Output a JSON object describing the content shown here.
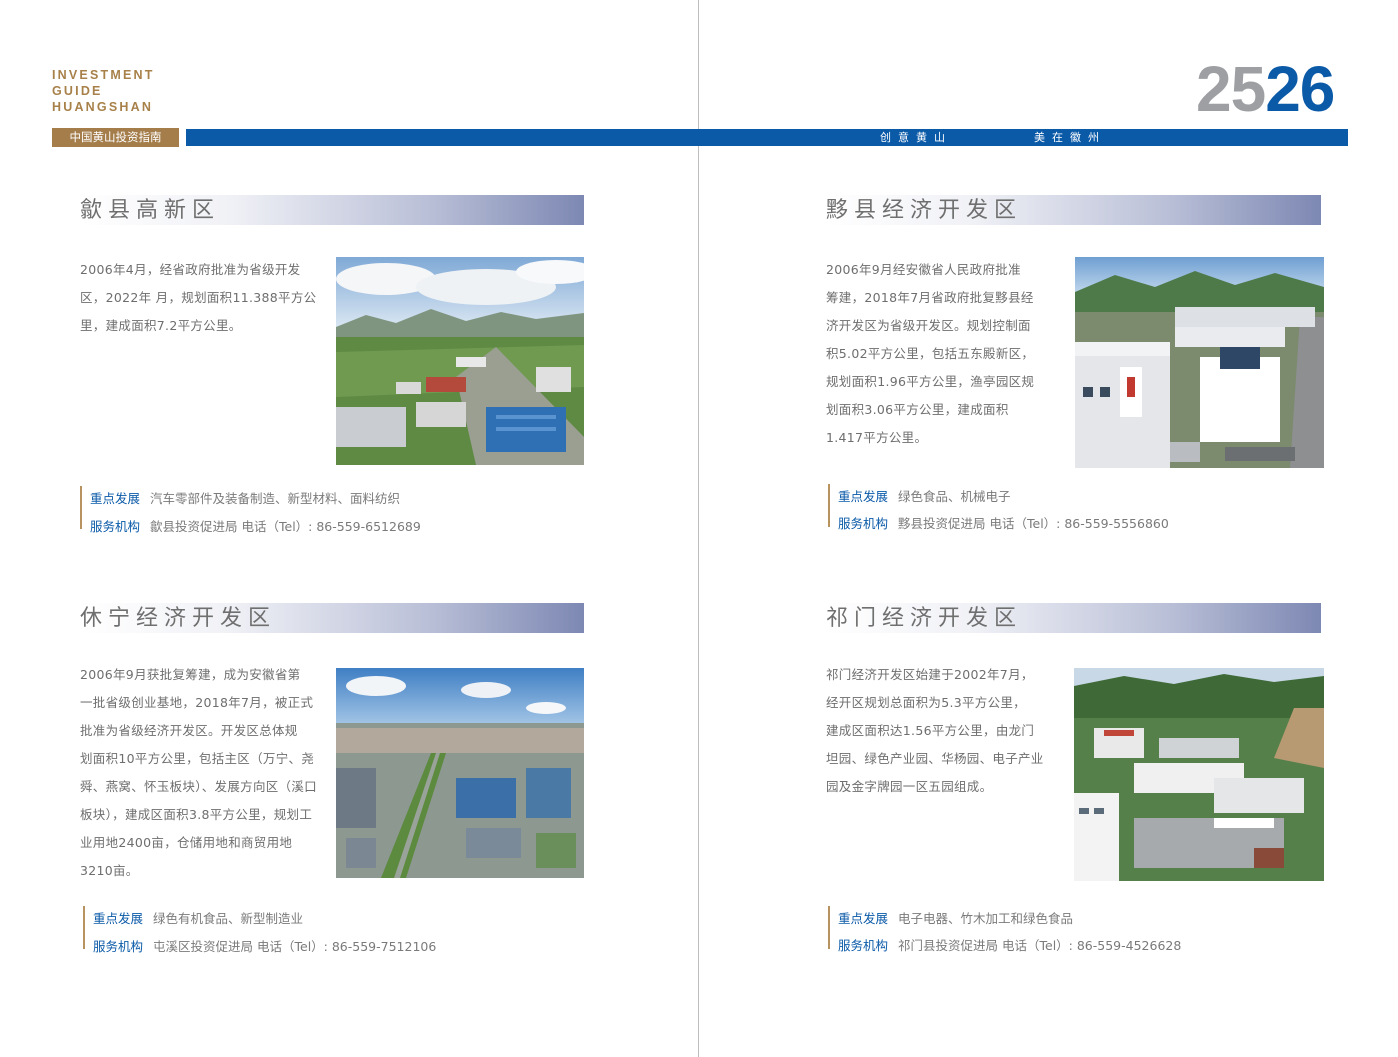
{
  "header": {
    "brand_line1": "INVESTMENT",
    "brand_line2": "GUIDE",
    "brand_line3": "HUANGSHAN",
    "guide_label": "中国黄山投资指南",
    "page_num_left": "25",
    "page_num_right": "26",
    "slogan_1": "创意黄山",
    "slogan_2": "美在徽州"
  },
  "sections": [
    {
      "title": "歙县高新区",
      "desc": [
        "2006年4月，经省政府批准为省级开发",
        "区，2022年 月，规划面积11.388平方公",
        "里，建成面积7.2平方公里。"
      ],
      "focus_key": "重点发展",
      "focus_value": "汽车零部件及装备制造、新型材料、面料纺织",
      "service_key": "服务机构",
      "service_value": "歙县投资促进局  电话（Tel）: 86-559-6512689"
    },
    {
      "title": "黟县经济开发区",
      "desc": [
        "2006年9月经安徽省人民政府批准",
        "筹建，2018年7月省政府批复黟县经",
        "济开发区为省级开发区。规划控制面",
        "积5.02平方公里，包括五东殿新区，",
        "规划面积1.96平方公里，渔亭园区规",
        "划面积3.06平方公里，建成面积",
        "1.417平方公里。"
      ],
      "focus_key": "重点发展",
      "focus_value": "绿色食品、机械电子",
      "service_key": "服务机构",
      "service_value": "黟县投资促进局  电话（Tel）: 86-559-5556860"
    },
    {
      "title": "休宁经济开发区",
      "desc": [
        "2006年9月获批复筹建，成为安徽省第",
        "一批省级创业基地，2018年7月，被正式",
        "批准为省级经济开发区。开发区总体规",
        "划面积10平方公里，包括主区（万宁、尧",
        "舜、燕窝、怀玉板块）、发展方向区（溪口",
        "板块），建成区面积3.8平方公里，规划工",
        "业用地2400亩，仓储用地和商贸用地",
        "3210亩。"
      ],
      "focus_key": "重点发展",
      "focus_value": "绿色有机食品、新型制造业",
      "service_key": "服务机构",
      "service_value": "屯溪区投资促进局  电话（Tel）: 86-559-7512106"
    },
    {
      "title": "祁门经济开发区",
      "desc": [
        "祁门经济开发区始建于2002年7月，",
        "经开区规划总面积为5.3平方公里，",
        "建成区面积达1.56平方公里，由龙门",
        "坦园、绿色产业园、华杨园、电子产业",
        "园及金字牌园一区五园组成。"
      ],
      "focus_key": "重点发展",
      "focus_value": "电子电器、竹木加工和绿色食品",
      "service_key": "服务机构",
      "service_value": "祁门县投资促进局  电话（Tel）: 86-559-4526628"
    }
  ]
}
